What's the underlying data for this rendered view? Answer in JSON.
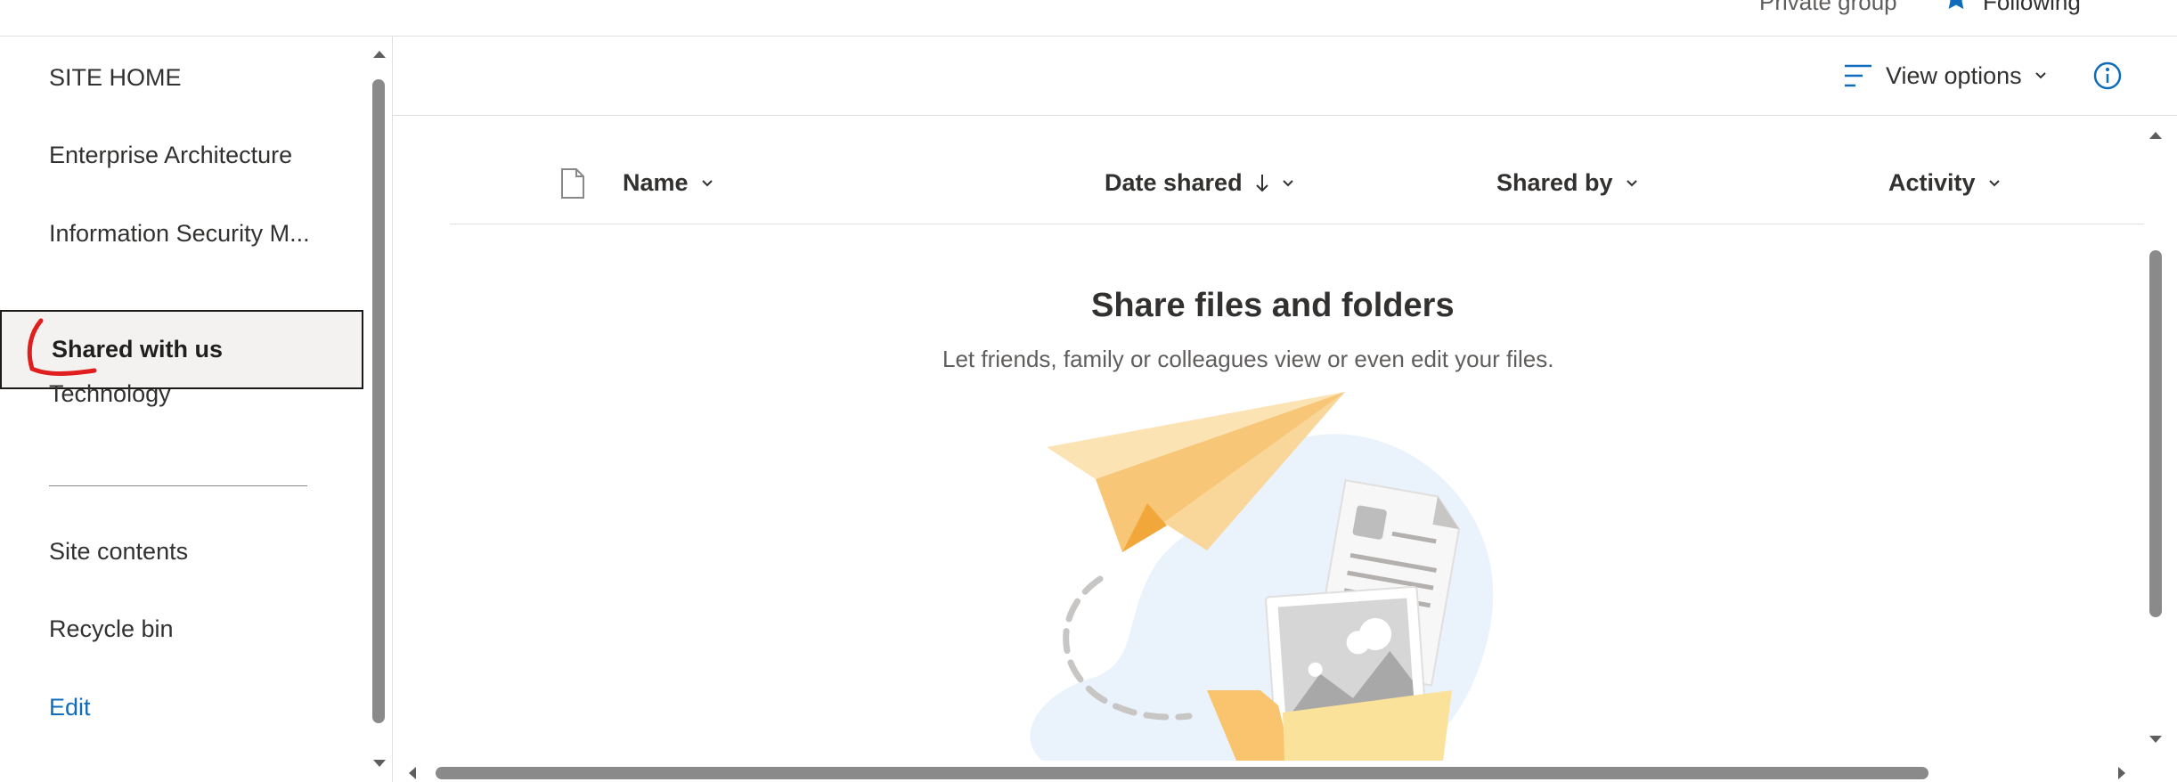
{
  "header": {
    "group_type": "Private group",
    "follow_label": "Following"
  },
  "nav": {
    "site_home": "SITE HOME",
    "items": [
      "Enterprise Architecture",
      "Information Security M...",
      "Shared with us",
      "Technology"
    ],
    "selected": "Shared with us",
    "site_contents": "Site contents",
    "recycle_bin": "Recycle bin",
    "edit": "Edit"
  },
  "commandbar": {
    "view_options": "View options"
  },
  "columns": {
    "name": "Name",
    "date_shared": "Date shared",
    "shared_by": "Shared by",
    "activity": "Activity"
  },
  "empty_state": {
    "title": "Share files and folders",
    "subtitle": "Let friends, family or colleagues view or even edit your files."
  },
  "colors": {
    "accent_blue": "#0078d4",
    "link_blue": "#0f6cbd",
    "annotation_red": "#e01e1e",
    "plane": "#f7c677",
    "folder": "#fbe29a",
    "blob": "#eaf3fc"
  },
  "icons": [
    "star-icon",
    "view-options-icon",
    "chevron-down-icon",
    "info-icon",
    "file-type-icon",
    "sort-down-arrow-icon",
    "scroll-up-arrow-icon",
    "scroll-down-arrow-icon",
    "scroll-left-arrow-icon",
    "scroll-right-arrow-icon"
  ]
}
